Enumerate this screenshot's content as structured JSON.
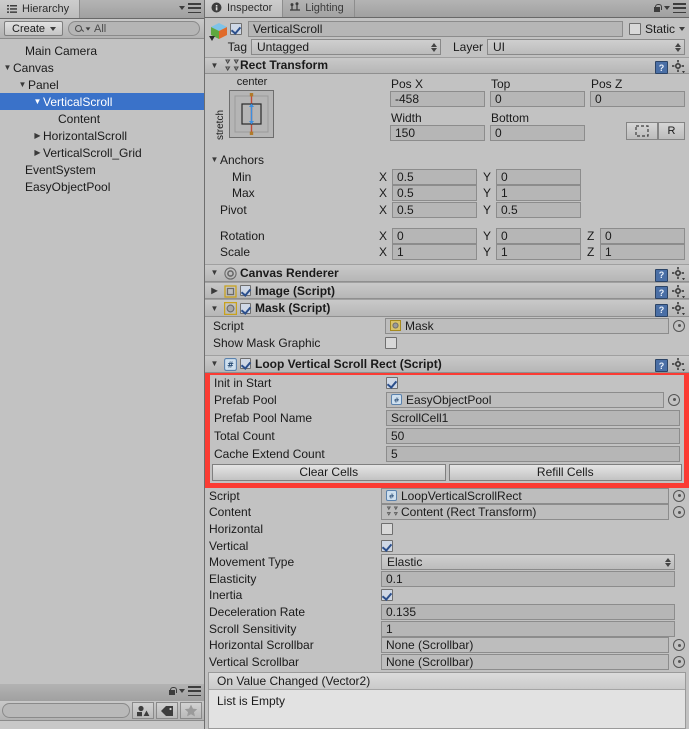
{
  "hierarchy": {
    "tab_label": "Hierarchy",
    "tab_icon": "list-icon",
    "create_label": "Create",
    "search_placeholder": "All",
    "items": [
      {
        "label": "Main Camera",
        "depth": 0,
        "arrow": "",
        "selected": false
      },
      {
        "label": "Canvas",
        "depth": 0,
        "arrow": "▼",
        "selected": false
      },
      {
        "label": "Panel",
        "depth": 1,
        "arrow": "▼",
        "selected": false
      },
      {
        "label": "VerticalScroll",
        "depth": 2,
        "arrow": "▼",
        "selected": true
      },
      {
        "label": "Content",
        "depth": 3,
        "arrow": "",
        "selected": false
      },
      {
        "label": "HorizontalScroll",
        "depth": 2,
        "arrow": "▶",
        "selected": false
      },
      {
        "label": "VerticalScroll_Grid",
        "depth": 2,
        "arrow": "▶",
        "selected": false
      },
      {
        "label": "EventSystem",
        "depth": 0,
        "arrow": "",
        "selected": false
      },
      {
        "label": "EasyObjectPool",
        "depth": 0,
        "arrow": "",
        "selected": false
      }
    ]
  },
  "project_strip": {
    "lock_icon": "lock-icon",
    "menu_icon": "panel-menu-icon",
    "search_value": "",
    "filter_buttons": [
      "shapes-filter-icon",
      "label-filter-icon",
      "favorite-star-icon"
    ]
  },
  "inspector": {
    "tabs": [
      {
        "label": "Inspector",
        "icon": "inspector-icon",
        "active": true
      },
      {
        "label": "Lighting",
        "icon": "lighting-icon",
        "active": false
      }
    ],
    "object": {
      "icon": "gameobject-cube-icon",
      "enabled": true,
      "name": "VerticalScroll",
      "static_label": "Static",
      "static_checked": false,
      "tag_label": "Tag",
      "tag_value": "Untagged",
      "layer_label": "Layer",
      "layer_value": "UI"
    },
    "rect_transform": {
      "title": "Rect Transform",
      "icon": "rect-transform-icon",
      "expanded": true,
      "anchor_preset_top": "center",
      "anchor_preset_side": "stretch",
      "col_headers": [
        "Pos X",
        "Top",
        "Pos Z"
      ],
      "row1_values": [
        "-458",
        "0",
        "0"
      ],
      "col_headers2": [
        "Width",
        "Bottom"
      ],
      "row2_values": [
        "150",
        "0"
      ],
      "blueprint_btn": "blueprint-mode-icon",
      "raw_btn": "R",
      "anchors_label": "Anchors",
      "min_label": "Min",
      "min": {
        "x": "0.5",
        "y": "0"
      },
      "max_label": "Max",
      "max": {
        "x": "0.5",
        "y": "1"
      },
      "pivot_label": "Pivot",
      "pivot": {
        "x": "0.5",
        "y": "0.5"
      },
      "rotation_label": "Rotation",
      "rotation": {
        "x": "0",
        "y": "0",
        "z": "0"
      },
      "scale_label": "Scale",
      "scale": {
        "x": "1",
        "y": "1",
        "z": "1"
      },
      "axis_x": "X",
      "axis_y": "Y",
      "axis_z": "Z"
    },
    "canvas_renderer": {
      "title": "Canvas Renderer",
      "icon": "canvas-renderer-icon",
      "expanded": true
    },
    "image_component": {
      "title": "Image (Script)",
      "icon": "image-script-icon",
      "enabled": true,
      "expanded": false
    },
    "mask_component": {
      "title": "Mask (Script)",
      "icon": "mask-script-icon",
      "enabled": true,
      "expanded": true,
      "script_label": "Script",
      "script_value": "Mask",
      "script_icon": "mono-script-icon",
      "show_mask_label": "Show Mask Graphic",
      "show_mask_checked": false
    },
    "loop_scroll": {
      "title": "Loop Vertical Scroll Rect (Script)",
      "icon": "cs-script-icon",
      "enabled": true,
      "expanded": true,
      "highlight_color": "#fb3b33",
      "highlighted_rows": [
        {
          "label": "Init in Start",
          "type": "checkbox",
          "checked": true
        },
        {
          "label": "Prefab Pool",
          "type": "object",
          "value": "EasyObjectPool",
          "icon": "gameobject-ref-icon"
        },
        {
          "label": "Prefab Pool Name",
          "type": "text",
          "value": "ScrollCell1"
        },
        {
          "label": "Total Count",
          "type": "text",
          "value": "50"
        },
        {
          "label": "Cache Extend Count",
          "type": "text",
          "value": "5"
        }
      ],
      "buttons": [
        "Clear Cells",
        "Refill Cells"
      ],
      "rows": [
        {
          "label": "Script",
          "type": "object",
          "value": "LoopVerticalScrollRect",
          "icon": "mono-script-icon"
        },
        {
          "label": "Content",
          "type": "object",
          "value": "Content (Rect Transform)",
          "icon": "rect-transform-icon"
        },
        {
          "label": "Horizontal",
          "type": "checkbox",
          "checked": false
        },
        {
          "label": "Vertical",
          "type": "checkbox",
          "checked": true
        },
        {
          "label": "Movement Type",
          "type": "enum",
          "value": "Elastic"
        },
        {
          "label": "Elasticity",
          "type": "text",
          "value": "0.1"
        },
        {
          "label": "Inertia",
          "type": "checkbox",
          "checked": true
        },
        {
          "label": "Deceleration Rate",
          "type": "text",
          "value": "0.135"
        },
        {
          "label": "Scroll Sensitivity",
          "type": "text",
          "value": "1"
        },
        {
          "label": "Horizontal Scrollbar",
          "type": "object",
          "value": "None (Scrollbar)",
          "icon": "none-ref-icon"
        },
        {
          "label": "Vertical Scrollbar",
          "type": "object",
          "value": "None (Scrollbar)",
          "icon": "none-ref-icon"
        }
      ],
      "event_header": "On Value Changed (Vector2)",
      "event_empty": "List is Empty"
    }
  },
  "colors": {
    "panel_bg": "#c2c2c2",
    "selection_blue": "#3a72c9",
    "highlight_red": "#fb3b33",
    "field_bg": "#b6b6b6"
  }
}
